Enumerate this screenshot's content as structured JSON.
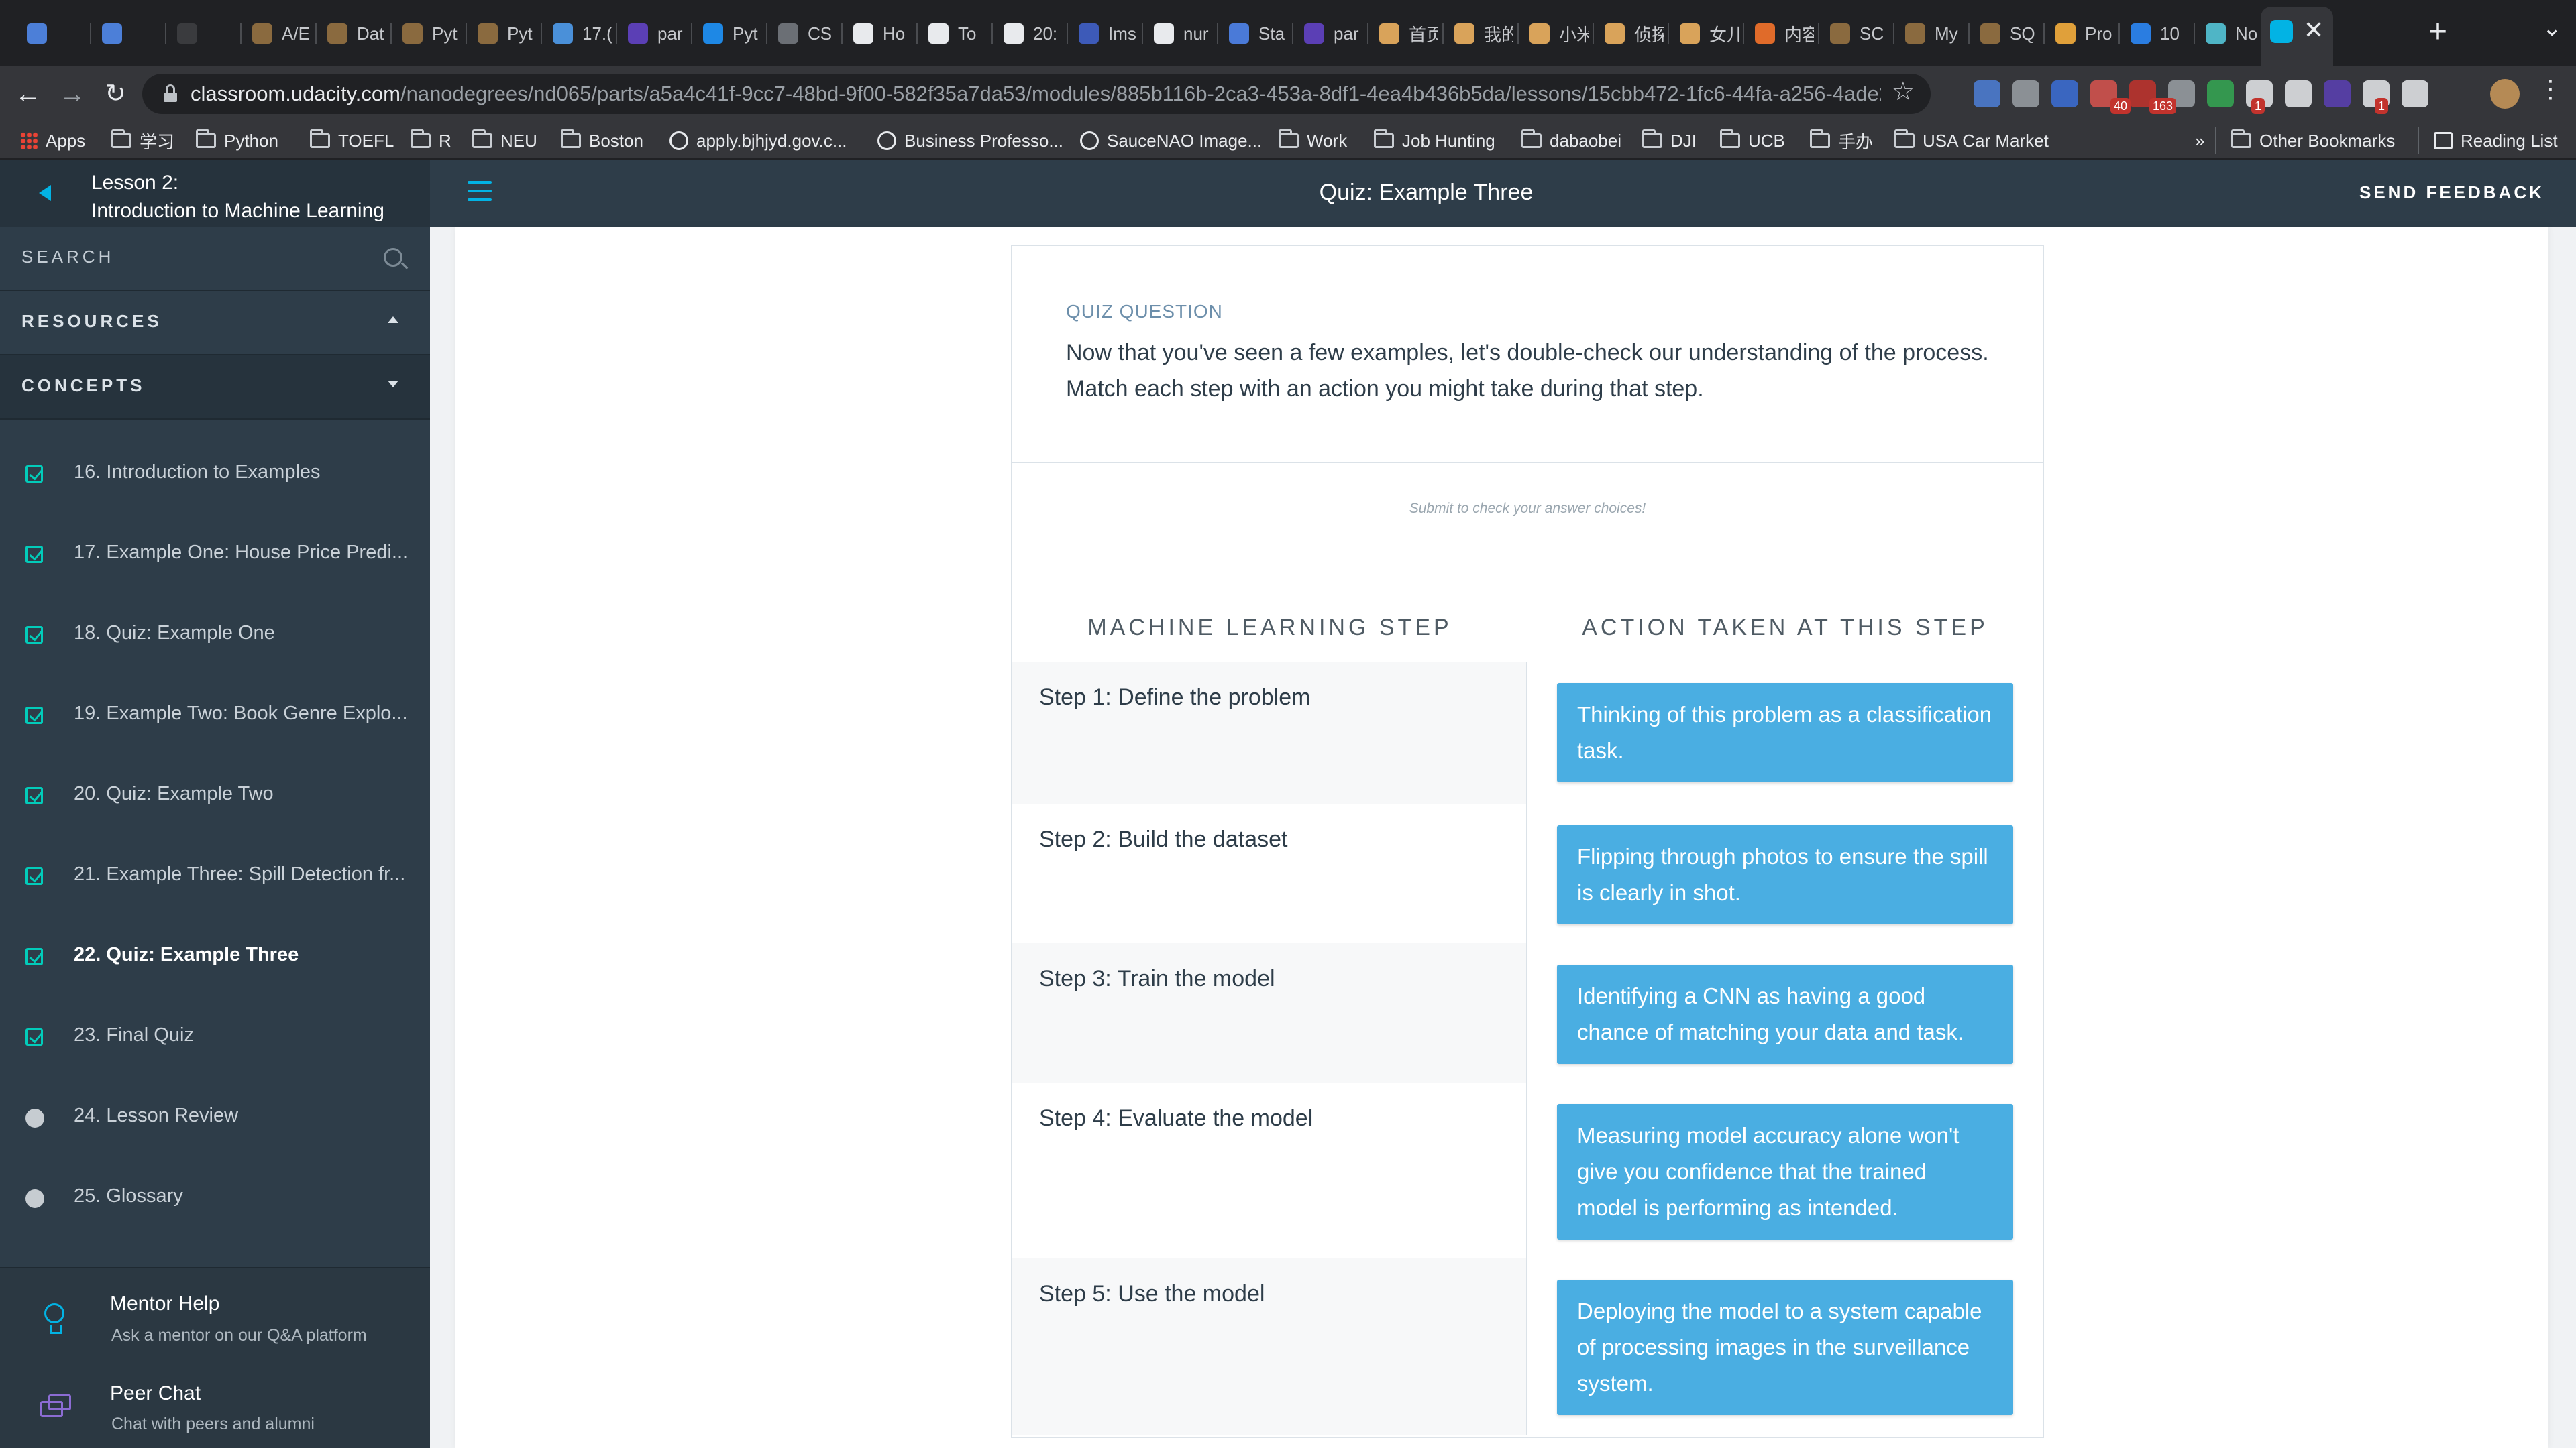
{
  "browser": {
    "tabs": [
      {
        "title": "",
        "color": "#4c7fd8"
      },
      {
        "title": "",
        "color": "#4c7fd8"
      },
      {
        "title": "",
        "color": "#3a3b3e"
      },
      {
        "title": "A/E",
        "color": "#8a6a3f"
      },
      {
        "title": "Dat",
        "color": "#8a6a3f"
      },
      {
        "title": "Pyt",
        "color": "#8a6a3f"
      },
      {
        "title": "Pyt",
        "color": "#8a6a3f"
      },
      {
        "title": "17.(",
        "color": "#4a90d9"
      },
      {
        "title": "par",
        "color": "#5b3fb5"
      },
      {
        "title": "Pyt",
        "color": "#1e88e5"
      },
      {
        "title": "CS",
        "color": "#6b6f75"
      },
      {
        "title": "Ho",
        "color": "#e8eaed"
      },
      {
        "title": "To",
        "color": "#e8eaed"
      },
      {
        "title": "20:",
        "color": "#e8eaed"
      },
      {
        "title": "Ims",
        "color": "#3d5ab8"
      },
      {
        "title": "nur",
        "color": "#e8eaed"
      },
      {
        "title": "Sta",
        "color": "#4a7ad8"
      },
      {
        "title": "par",
        "color": "#5b3fb5"
      },
      {
        "title": "首页",
        "color": "#d9a35a"
      },
      {
        "title": "我的",
        "color": "#d9a35a"
      },
      {
        "title": "小米",
        "color": "#d9a35a"
      },
      {
        "title": "侦探",
        "color": "#d9a35a"
      },
      {
        "title": "女儿",
        "color": "#d9a35a"
      },
      {
        "title": "内容",
        "color": "#e06b2a"
      },
      {
        "title": "SC",
        "color": "#8a6a3f"
      },
      {
        "title": "My",
        "color": "#8a6a3f"
      },
      {
        "title": "SQ",
        "color": "#8a6a3f"
      },
      {
        "title": "Pro",
        "color": "#e0a03a"
      },
      {
        "title": "10",
        "color": "#2a7de1"
      },
      {
        "title": "No",
        "color": "#4fb5c6"
      }
    ],
    "url_host": "classroom.udacity.com",
    "url_path": "/nanodegrees/nd065/parts/a5a4c41f-9cc7-48bd-9f00-582f35a7da53/modules/885b116b-2ca3-453a-8df1-4ea4b436b5da/lessons/15cbb472-1fc6-44fa-a256-4ade21...",
    "ext_badges": [
      "40",
      "163",
      "1",
      "1"
    ],
    "bookmarks": [
      {
        "label": "Apps",
        "icon": "apps-grid-icon"
      },
      {
        "label": "学习",
        "icon": "folder-icon"
      },
      {
        "label": "Python",
        "icon": "folder-icon"
      },
      {
        "label": "TOEFL",
        "icon": "folder-icon"
      },
      {
        "label": "R",
        "icon": "folder-icon"
      },
      {
        "label": "NEU",
        "icon": "folder-icon"
      },
      {
        "label": "Boston",
        "icon": "folder-icon"
      },
      {
        "label": "apply.bjhjyd.gov.c...",
        "icon": "globe-icon"
      },
      {
        "label": "Business Professo...",
        "icon": "person-icon"
      },
      {
        "label": "SauceNAO Image...",
        "icon": "x-icon"
      },
      {
        "label": "Work",
        "icon": "folder-icon"
      },
      {
        "label": "Job Hunting",
        "icon": "folder-icon"
      },
      {
        "label": "dabaobei",
        "icon": "folder-icon"
      },
      {
        "label": "DJI",
        "icon": "folder-icon"
      },
      {
        "label": "UCB",
        "icon": "folder-icon"
      },
      {
        "label": "手办",
        "icon": "folder-icon"
      },
      {
        "label": "USA Car Market",
        "icon": "folder-icon"
      }
    ],
    "bookmarks_overflow": "»",
    "other_bookmarks": "Other Bookmarks",
    "reading_list": "Reading List"
  },
  "sidebar": {
    "lesson_number": "Lesson 2:",
    "lesson_title": "Introduction to Machine Learning",
    "search_label": "SEARCH",
    "resources_label": "RESOURCES",
    "concepts_label": "CONCEPTS",
    "concepts": [
      {
        "label": "16. Introduction to Examples",
        "status": "done"
      },
      {
        "label": "17. Example One: House Price Predi...",
        "status": "done"
      },
      {
        "label": "18. Quiz: Example One",
        "status": "done"
      },
      {
        "label": "19. Example Two: Book Genre Explo...",
        "status": "done"
      },
      {
        "label": "20. Quiz: Example Two",
        "status": "done"
      },
      {
        "label": "21. Example Three: Spill Detection fr...",
        "status": "done"
      },
      {
        "label": "22. Quiz: Example Three",
        "status": "current"
      },
      {
        "label": "23. Final Quiz",
        "status": "done"
      },
      {
        "label": "24. Lesson Review",
        "status": "todo"
      },
      {
        "label": "25. Glossary",
        "status": "todo"
      }
    ],
    "mentor_help_title": "Mentor Help",
    "mentor_help_sub": "Ask a mentor on our Q&A platform",
    "peer_chat_title": "Peer Chat",
    "peer_chat_sub": "Chat with peers and alumni"
  },
  "header": {
    "title": "Quiz: Example Three",
    "send_feedback": "SEND FEEDBACK"
  },
  "quiz": {
    "label": "QUIZ QUESTION",
    "question": "Now that you've seen a few examples, let's double-check our understanding of the process. Match each step with an action you might take during that step.",
    "submit_hint": "Submit to check your answer choices!",
    "col_left": "MACHINE LEARNING STEP",
    "col_right": "ACTION TAKEN AT THIS STEP",
    "rows": [
      {
        "step": "Step 1: Define the problem",
        "action": "Thinking of this problem as a classification task."
      },
      {
        "step": "Step 2: Build the dataset",
        "action": "Flipping through photos to ensure the spill is clearly in shot."
      },
      {
        "step": "Step 3: Train the model",
        "action": "Identifying a CNN as having a good chance of matching your data and task."
      },
      {
        "step": "Step 4: Evaluate the model",
        "action": "Measuring model accuracy alone won't give you confidence that the trained model is performing as intended."
      },
      {
        "step": "Step 5: Use the model",
        "action": "Deploying the model to a system capable of processing images in the surveillance system."
      }
    ]
  },
  "colors": {
    "accent": "#02b3e4",
    "chip": "#4aaee2",
    "sidebar": "#2e3d49",
    "check": "#02ccba"
  }
}
